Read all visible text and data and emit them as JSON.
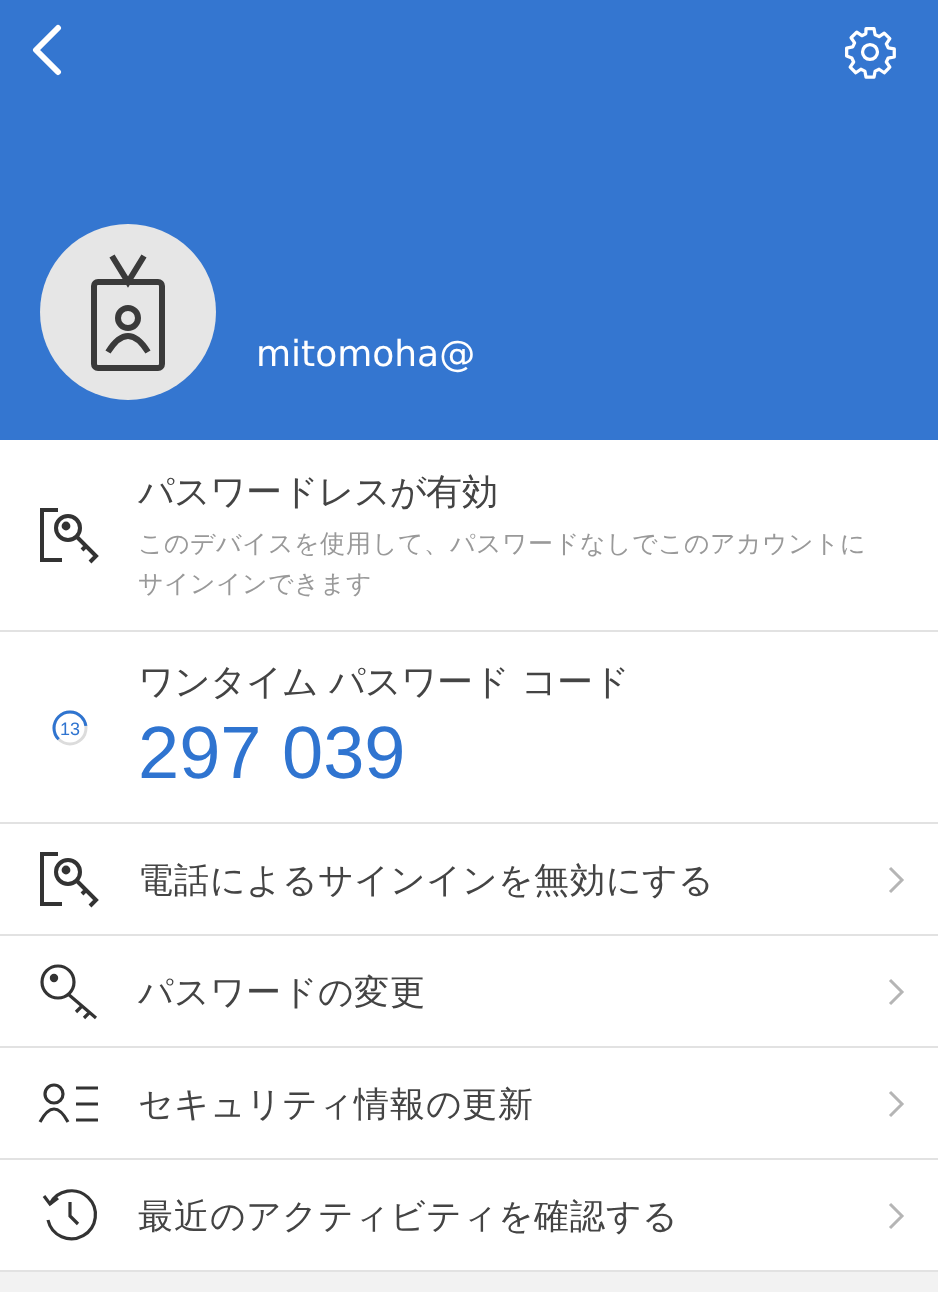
{
  "header": {
    "username": "mitomoha@"
  },
  "passwordless": {
    "title": "パスワードレスが有効",
    "description": "このデバイスを使用して、パスワードなしでこのアカウントにサインインできます"
  },
  "otp": {
    "title": "ワンタイム パスワード コード",
    "code": "297 039",
    "seconds": "13"
  },
  "actions": [
    {
      "kind": "phone-key",
      "label": "電話によるサインインを無効にする"
    },
    {
      "kind": "key",
      "label": "パスワードの変更"
    },
    {
      "kind": "person-list",
      "label": "セキュリティ情報の更新"
    },
    {
      "kind": "history",
      "label": "最近のアクティビティを確認する"
    }
  ]
}
